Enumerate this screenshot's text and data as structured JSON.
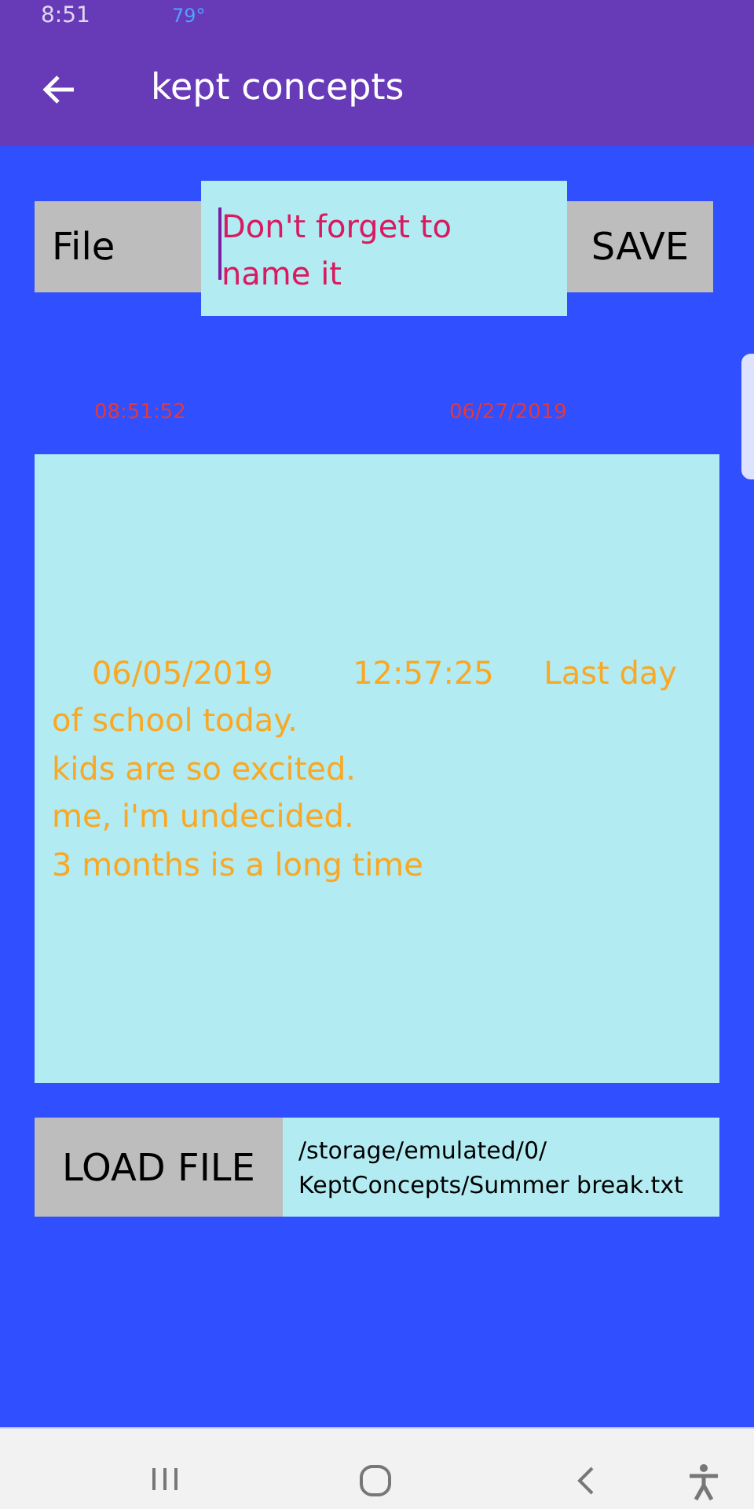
{
  "status_bar": {
    "time": "8:51",
    "temperature": "79°"
  },
  "app_bar": {
    "title": "kept concepts"
  },
  "file_row": {
    "file_button": "File",
    "name_field": {
      "value": "Don't forget to name it"
    },
    "save_button": "SAVE"
  },
  "timestamp": {
    "time": "08:51:52",
    "date": "06/27/2019"
  },
  "note": {
    "text": "    06/05/2019        12:57:25     Last day of school today.\nkids are so excited.\nme, i'm undecided.\n3 months is a long time"
  },
  "load_row": {
    "load_button": "LOAD FILE",
    "path": "/storage/emulated/0/\nKeptConcepts/Summer break.txt"
  }
}
